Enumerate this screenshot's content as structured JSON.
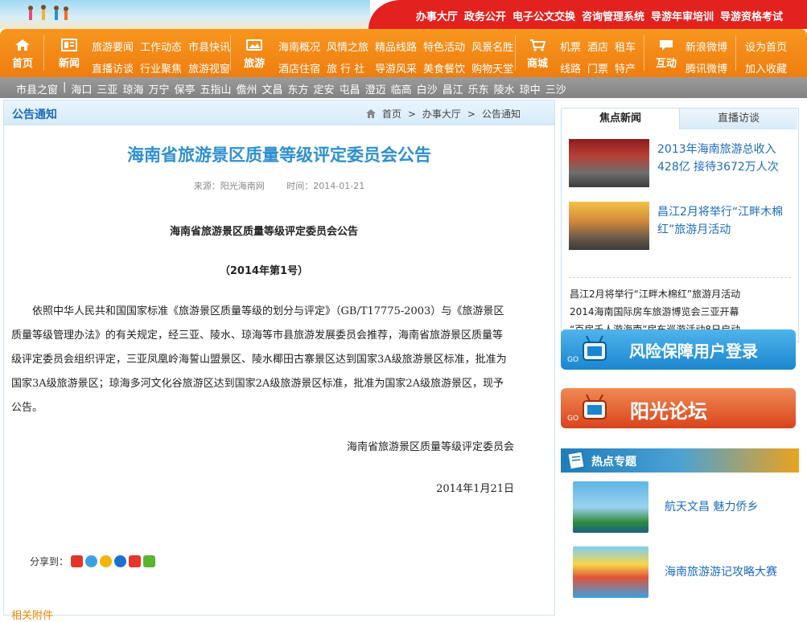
{
  "topnav": [
    "办事大厅",
    "政务公开",
    "电子公文交换",
    "咨询管理系统",
    "导游年审培训",
    "导游资格考试"
  ],
  "nav": {
    "home": {
      "label": "首页",
      "icon": "home-icon"
    },
    "news": {
      "label": "新闻",
      "icon": "news-icon",
      "links": [
        "旅游要闻",
        "工作动态",
        "市县快讯",
        "直播访谈",
        "行业聚焦",
        "旅游视窗"
      ]
    },
    "travel": {
      "label": "旅游",
      "icon": "photo-icon",
      "links": [
        "海南概况",
        "风情之旅",
        "精品线路",
        "特色活动",
        "风景名胜",
        "酒店住宿",
        "旅 行 社",
        "导游风采",
        "美食餐饮",
        "购物天堂"
      ]
    },
    "mall": {
      "label": "商城",
      "icon": "cart-icon",
      "links": [
        "机票",
        "酒店",
        "租车",
        "线路",
        "门票",
        "特产"
      ]
    },
    "interact": {
      "label": "互动",
      "icon": "chat-icon",
      "links": [
        "新浪微博",
        "腾讯微博"
      ]
    },
    "extra": [
      "设为首页",
      "加入收藏"
    ]
  },
  "citybar": {
    "label": "市县之窗",
    "sep": "|",
    "cities": [
      "海口",
      "三亚",
      "琼海",
      "万宁",
      "保亭",
      "五指山",
      "儋州",
      "文昌",
      "东方",
      "定安",
      "屯昌",
      "澄迈",
      "临高",
      "白沙",
      "昌江",
      "乐东",
      "陵水",
      "琼中",
      "三沙"
    ]
  },
  "left": {
    "section_title": "公告通知",
    "breadcrumb": [
      "首页",
      "办事大厅",
      "公告通知"
    ],
    "breadcrumb_sep": ">",
    "article": {
      "title": "海南省旅游景区质量等级评定委员会公告",
      "source": "来源：阳光海南网",
      "time": "时间：2014-01-21",
      "subtitle": "海南省旅游景区质量等级评定委员会公告",
      "number": "（2014年第1号）",
      "body": "依照中华人民共和国国家标准《旅游景区质量等级的划分与评定》（GB/T17775-2003）与《旅游景区质量等级管理办法》的有关规定，经三亚、陵水、琼海等市县旅游发展委员会推荐，海南省旅游景区质量等级评定委员会组织评定，三亚凤凰岭海誓山盟景区、陵水椰田古寨景区达到国家3A级旅游景区标准，批准为国家3A级旅游景区；琼海多河文化谷旅游区达到国家2A级旅游景区标准，批准为国家2A级旅游景区，现予公告。",
      "signature": "海南省旅游景区质量等级评定委员会",
      "date": "2014年1月21日"
    },
    "share_label": "分享到：",
    "bottom_fragment": "相关附件"
  },
  "right": {
    "tabs": [
      "焦点新闻",
      "直播访谈"
    ],
    "featured": [
      {
        "text": "2013年海南旅游总收入428亿 接待3672万人次"
      },
      {
        "text": "昌江2月将举行“江畔木棉红”旅游月活动"
      }
    ],
    "list": [
      "昌江2月将举行“江畔木棉红”旅游月活动",
      "2014海南国际房车旅游博览会三亚开幕",
      "“百房千人游海南”房车巡游活动8日启动"
    ],
    "banners": [
      {
        "text": "风险保障用户登录",
        "go": "GO"
      },
      {
        "text": "阳光论坛",
        "go": "GO"
      }
    ],
    "hot_title": "热点专题",
    "topics": [
      {
        "text": "航天文昌 魅力侨乡"
      },
      {
        "text": "海南旅游游记攻略大赛"
      }
    ]
  },
  "colors": {
    "orange": "#f08a14",
    "red": "#e3211e",
    "blue": "#1e6cb8",
    "title_blue": "#2f8fd0"
  }
}
